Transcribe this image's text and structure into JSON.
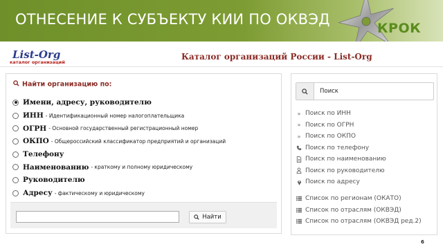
{
  "slide": {
    "title": "ОТНЕСЕНИЕ К СУБЪЕКТУ КИИ ПО ОКВЭД",
    "brand": "КРОК",
    "page_number": "6"
  },
  "site": {
    "logo_text": "List-Org",
    "logo_subtitle": "каталог организаций",
    "title": "Каталог организаций России - List-Org"
  },
  "search_panel": {
    "heading": "Найти организацию по:",
    "options": [
      {
        "label": "Имени, адресу, руководителю",
        "desc": "",
        "selected": true
      },
      {
        "label": "ИНН",
        "desc": "- Идентификационный номер налогоплательщика",
        "selected": false
      },
      {
        "label": "ОГРН",
        "desc": "- Основной государственный регистрационный номер",
        "selected": false
      },
      {
        "label": "ОКПО",
        "desc": "- Общероссийский классификатор предприятий и организаций",
        "selected": false
      },
      {
        "label": "Телефону",
        "desc": "",
        "selected": false
      },
      {
        "label": "Наименованию",
        "desc": "- краткому и полному юридическому",
        "selected": false
      },
      {
        "label": "Руководителю",
        "desc": "",
        "selected": false
      },
      {
        "label": "Адресу",
        "desc": "- фактическому и юридическому",
        "selected": false
      }
    ],
    "input_value": "",
    "button_label": "Найти"
  },
  "sidebar": {
    "search_placeholder": "Поиск",
    "links": [
      {
        "icon": "double-chevron-icon",
        "label": "Поиск по ИНН"
      },
      {
        "icon": "double-chevron-icon",
        "label": "Поиск по ОГРН"
      },
      {
        "icon": "double-chevron-icon",
        "label": "Поиск по ОКПО"
      },
      {
        "icon": "phone-icon",
        "label": "Поиск по телефону"
      },
      {
        "icon": "document-icon",
        "label": "Поиск по наименованию"
      },
      {
        "icon": "user-icon",
        "label": "Поиск по руководителю"
      },
      {
        "icon": "map-marker-icon",
        "label": "Поиск по адресу"
      }
    ],
    "lists": [
      {
        "icon": "list-icon",
        "label": "Список по регионам (ОКАТО)"
      },
      {
        "icon": "list-icon",
        "label": "Список по отраслям (ОКВЭД)"
      },
      {
        "icon": "list-icon",
        "label": "Список по отраслям (ОКВЭД ред.2)"
      }
    ]
  },
  "colors": {
    "banner": "#7d9c33",
    "brand_green": "#5b8c1e",
    "heading_red": "#8a2a24",
    "logo_blue": "#2b3c8c"
  }
}
